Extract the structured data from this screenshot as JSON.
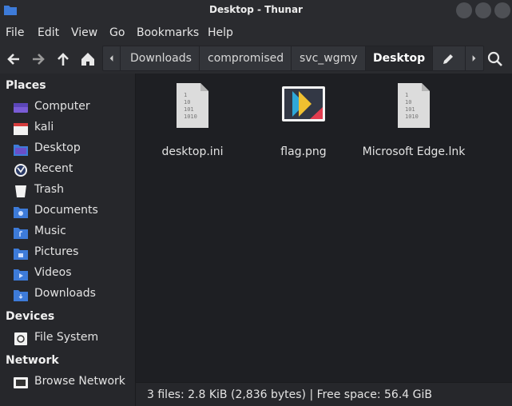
{
  "window": {
    "title": "Desktop - Thunar"
  },
  "menu": {
    "items": [
      "File",
      "Edit",
      "View",
      "Go",
      "Bookmarks",
      "Help"
    ]
  },
  "pathbar": {
    "crumbs": [
      "Downloads",
      "compromised",
      "svc_wgmy",
      "Desktop"
    ],
    "active_index": 3
  },
  "sidebar": {
    "places_header": "Places",
    "places": [
      {
        "label": "Computer",
        "icon": "computer-icon"
      },
      {
        "label": "kali",
        "icon": "home-folder-icon"
      },
      {
        "label": "Desktop",
        "icon": "desktop-folder-icon"
      },
      {
        "label": "Recent",
        "icon": "recent-icon"
      },
      {
        "label": "Trash",
        "icon": "trash-icon"
      },
      {
        "label": "Documents",
        "icon": "documents-folder-icon"
      },
      {
        "label": "Music",
        "icon": "music-folder-icon"
      },
      {
        "label": "Pictures",
        "icon": "pictures-folder-icon"
      },
      {
        "label": "Videos",
        "icon": "videos-folder-icon"
      },
      {
        "label": "Downloads",
        "icon": "downloads-folder-icon"
      }
    ],
    "devices_header": "Devices",
    "devices": [
      {
        "label": "File System",
        "icon": "drive-icon"
      }
    ],
    "network_header": "Network",
    "network": [
      {
        "label": "Browse Network",
        "icon": "network-icon"
      }
    ]
  },
  "files": [
    {
      "name": "desktop.ini",
      "icon": "binary-file-icon"
    },
    {
      "name": "flag.png",
      "icon": "image-file-icon"
    },
    {
      "name": "Microsoft Edge.lnk",
      "icon": "binary-file-icon"
    }
  ],
  "status": {
    "text": "3 files: 2.8 KiB (2,836 bytes)  |  Free space: 56.4 GiB"
  },
  "colors": {
    "folder_blue": "#3d7bd9",
    "bg_dark": "#1e1f23",
    "panel": "#26272b"
  }
}
